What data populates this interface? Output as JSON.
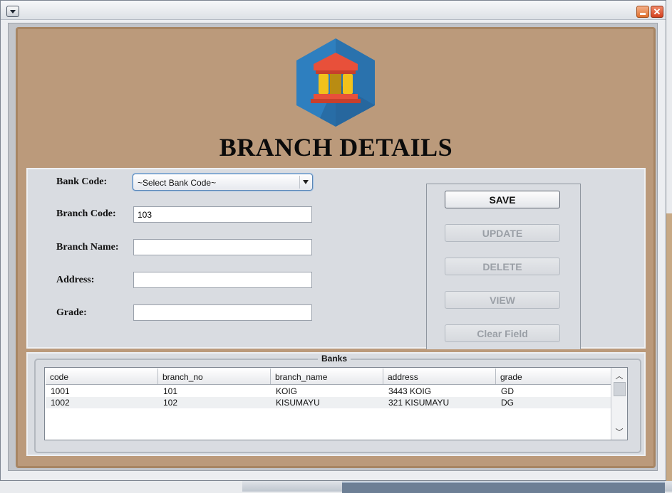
{
  "page": {
    "title": "BRANCH DETAILS"
  },
  "form": {
    "bank_code_label": "Bank Code:",
    "bank_code_selected": "~Select Bank Code~",
    "branch_code_label": "Branch Code:",
    "branch_code_value": "103",
    "branch_name_label": "Branch Name:",
    "branch_name_value": "",
    "address_label": "Address:",
    "address_value": "",
    "grade_label": "Grade:",
    "grade_value": ""
  },
  "buttons": {
    "save": "SAVE",
    "update": "UPDATE",
    "delete": "DELETE",
    "view": "VIEW",
    "clear": "Clear Field"
  },
  "table": {
    "group_title": "Banks",
    "columns": [
      "code",
      "branch_no",
      "branch_name",
      "address",
      "grade"
    ],
    "rows": [
      [
        "1001",
        "101",
        "KOIG",
        "3443 KOIG",
        "GD"
      ],
      [
        "1002",
        "102",
        "KISUMAYU",
        "321 KISUMAYU",
        "DG"
      ]
    ]
  },
  "icons": {
    "window_menu": "chevron-down-icon",
    "minimize": "minimize-icon",
    "close": "close-icon",
    "logo": "bank-building-icon",
    "scroll_up": "chevron-up-icon",
    "scroll_down": "chevron-down-icon"
  },
  "colors": {
    "background_brown": "#bb9a7b",
    "panel": "#d9dce1",
    "logo_hex": "#2e7fbf",
    "logo_building": "#e8503a",
    "logo_columns": "#f2c21b"
  }
}
